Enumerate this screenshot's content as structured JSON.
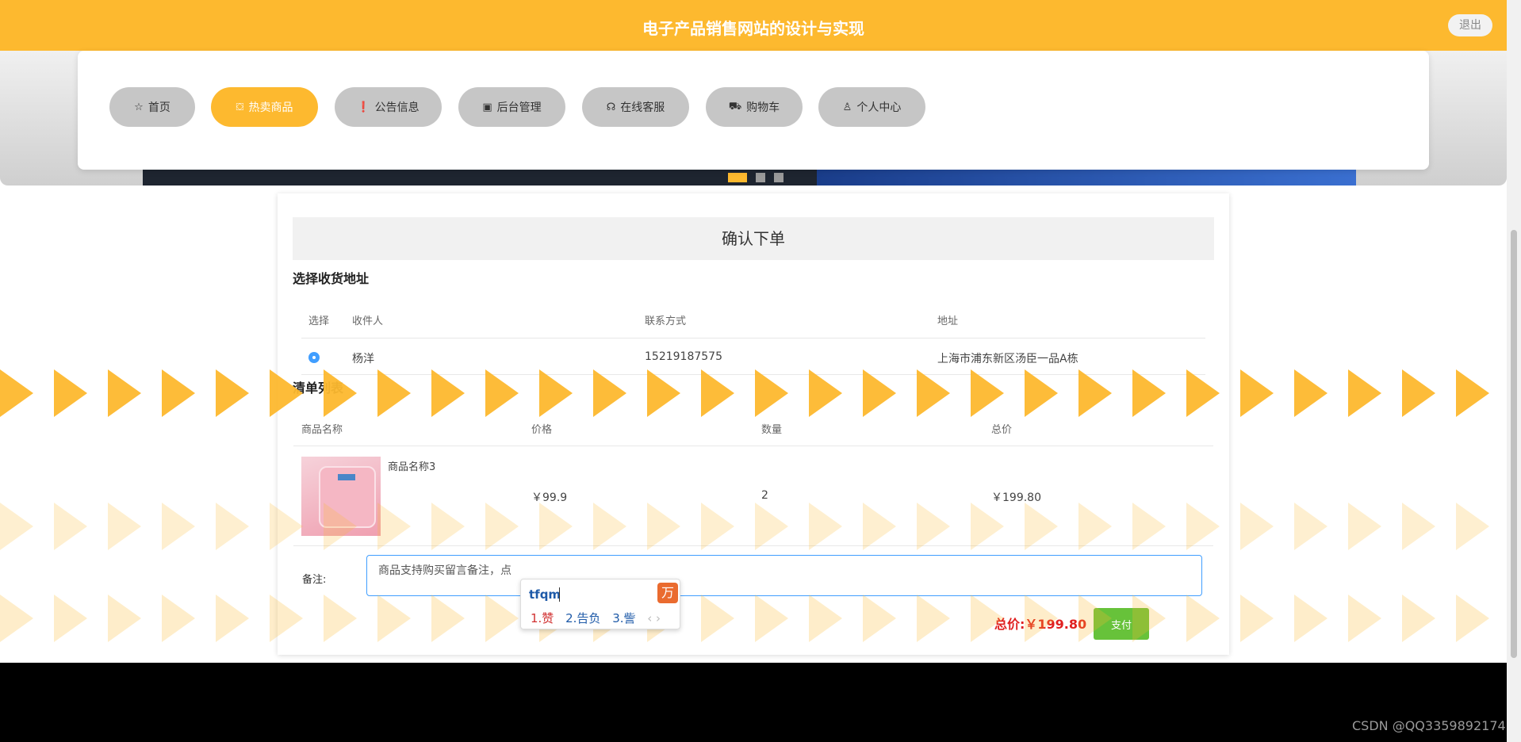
{
  "header": {
    "title": "电子产品销售网站的设计与实现",
    "logout_label": "退出",
    "accent_color": "#fdb92f"
  },
  "nav": {
    "items": [
      {
        "label": "首页",
        "icon": "star-icon",
        "glyph": "☆",
        "active": false
      },
      {
        "label": "热卖商品",
        "icon": "bag-icon",
        "glyph": "⛋",
        "active": true
      },
      {
        "label": "公告信息",
        "icon": "info-icon",
        "glyph": "❗",
        "active": false
      },
      {
        "label": "后台管理",
        "icon": "box-icon",
        "glyph": "▣",
        "active": false
      },
      {
        "label": "在线客服",
        "icon": "headset-icon",
        "glyph": "☊",
        "active": false
      },
      {
        "label": "购物车",
        "icon": "cart-icon",
        "glyph": "⛟",
        "active": false
      },
      {
        "label": "个人中心",
        "icon": "user-icon",
        "glyph": "♙",
        "active": false
      }
    ]
  },
  "carousel": {
    "slide_count": 3,
    "active_index": 0
  },
  "order": {
    "heading": "确认下单",
    "address_section_title": "选择收货地址",
    "address_headers": [
      "选择",
      "收件人",
      "联系方式",
      "地址"
    ],
    "address_rows": [
      {
        "selected": true,
        "recipient": "杨洋",
        "phone": "15219187575",
        "address": "上海市浦东新区汤臣一品A栋"
      }
    ],
    "items_section_title": "清单列表",
    "item_headers": [
      "商品名称",
      "价格",
      "数量",
      "总价"
    ],
    "items": [
      {
        "name": "商品名称3",
        "price": "￥99.9",
        "quantity": "2",
        "subtotal": "￥199.80"
      }
    ],
    "remark_label": "备注:",
    "remark_value": "商品支持购买留言备注，点",
    "total_label": "总价:",
    "total_value": "￥199.80",
    "pay_label": "支付"
  },
  "ime": {
    "pinyin": "tfqm",
    "candidates": [
      "1.赞",
      "2.告负",
      "3.訾"
    ],
    "candidate_colors": [
      "#d03030",
      "#1e5aa8",
      "#1e5aa8"
    ],
    "logo_glyph": "万"
  },
  "watermark": "CSDN @QQ3359892174"
}
